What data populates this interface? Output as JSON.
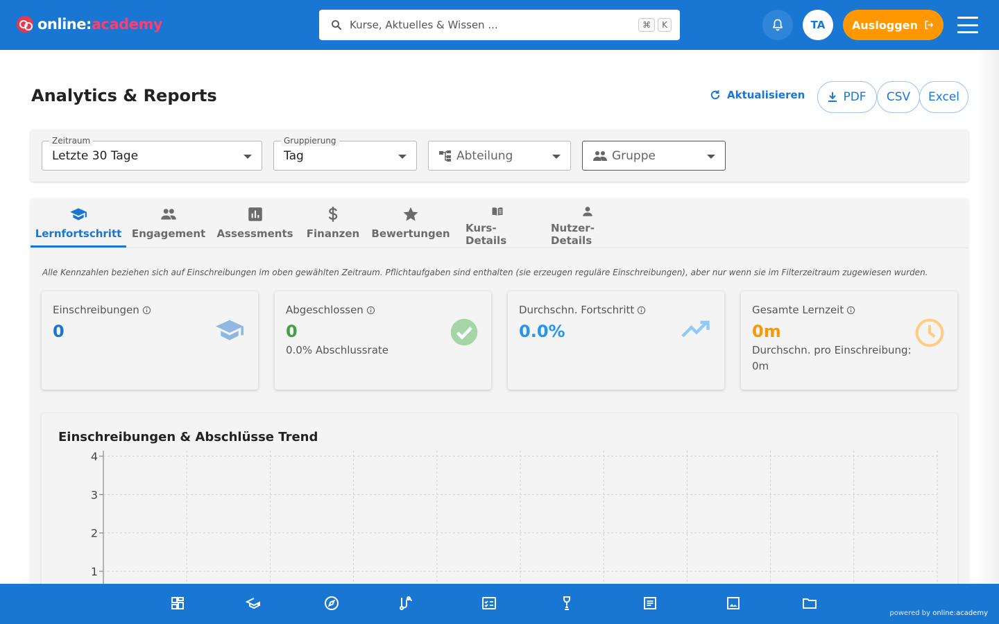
{
  "header": {
    "logo_prefix": "online:",
    "logo_suffix": "academy",
    "search_placeholder": "Kurse, Aktuelles & Wissen ...",
    "kbd_cmd": "⌘",
    "kbd_key": "K",
    "avatar_initials": "TA",
    "logout_label": "Ausloggen"
  },
  "page": {
    "title": "Analytics & Reports",
    "refresh_label": "Aktualisieren",
    "exports": [
      "PDF",
      "CSV",
      "Excel"
    ]
  },
  "filters": {
    "period": {
      "label": "Zeitraum",
      "value": "Letzte 30 Tage"
    },
    "grouping": {
      "label": "Gruppierung",
      "value": "Tag"
    },
    "department": {
      "placeholder": "Abteilung"
    },
    "group": {
      "placeholder": "Gruppe"
    }
  },
  "tabs": [
    {
      "label": "Lernfortschritt",
      "icon": "school-icon",
      "active": true
    },
    {
      "label": "Engagement",
      "icon": "people-icon"
    },
    {
      "label": "Assessments",
      "icon": "bar-chart-icon"
    },
    {
      "label": "Finanzen",
      "icon": "dollar-icon"
    },
    {
      "label": "Bewertungen",
      "icon": "star-icon"
    },
    {
      "label": "Kurs-Details",
      "icon": "book-icon"
    },
    {
      "label": "Nutzer-Details",
      "icon": "person-icon"
    }
  ],
  "note": "Alle Kennzahlen beziehen sich auf Einschreibungen im oben gewählten Zeitraum. Pflichtaufgaben sind enthalten (sie erzeugen reguläre Einschreibungen), aber nur wenn sie im Filterzeitraum zugewiesen wurden.",
  "kpis": [
    {
      "label": "Einschreibungen",
      "value": "0",
      "sub": "",
      "color": "#1976d2",
      "icon": "school-icon"
    },
    {
      "label": "Abgeschlossen",
      "value": "0",
      "sub": "0.0% Abschlussrate",
      "color": "#43a047",
      "icon": "check-circle-icon"
    },
    {
      "label": "Durchschn. Fortschritt",
      "value": "0.0%",
      "sub": "",
      "color": "#2196f3",
      "icon": "trending-up-icon"
    },
    {
      "label": "Gesamte Lernzeit",
      "value": "0m",
      "sub": "Durchschn. pro Einschreibung: 0m",
      "color": "#ff9800",
      "icon": "clock-icon"
    }
  ],
  "chart_data": {
    "type": "line",
    "title": "Einschreibungen & Abschlüsse Trend",
    "y_ticks": [
      "4",
      "3",
      "2",
      "1"
    ],
    "ylim": [
      0,
      4
    ],
    "grid": true,
    "series": []
  },
  "bottom_nav": [
    "dashboard-icon",
    "school-icon",
    "compass-icon",
    "route-icon",
    "checklist-icon",
    "trophy-icon",
    "article-icon",
    "image-icon",
    "folder-icon"
  ],
  "footer": {
    "powered_prefix": "powered by",
    "powered_brand": "online:academy"
  },
  "colors": {
    "primary": "#1976d2",
    "accent": "#ff9800",
    "logo_accent": "#ff3d6e"
  }
}
